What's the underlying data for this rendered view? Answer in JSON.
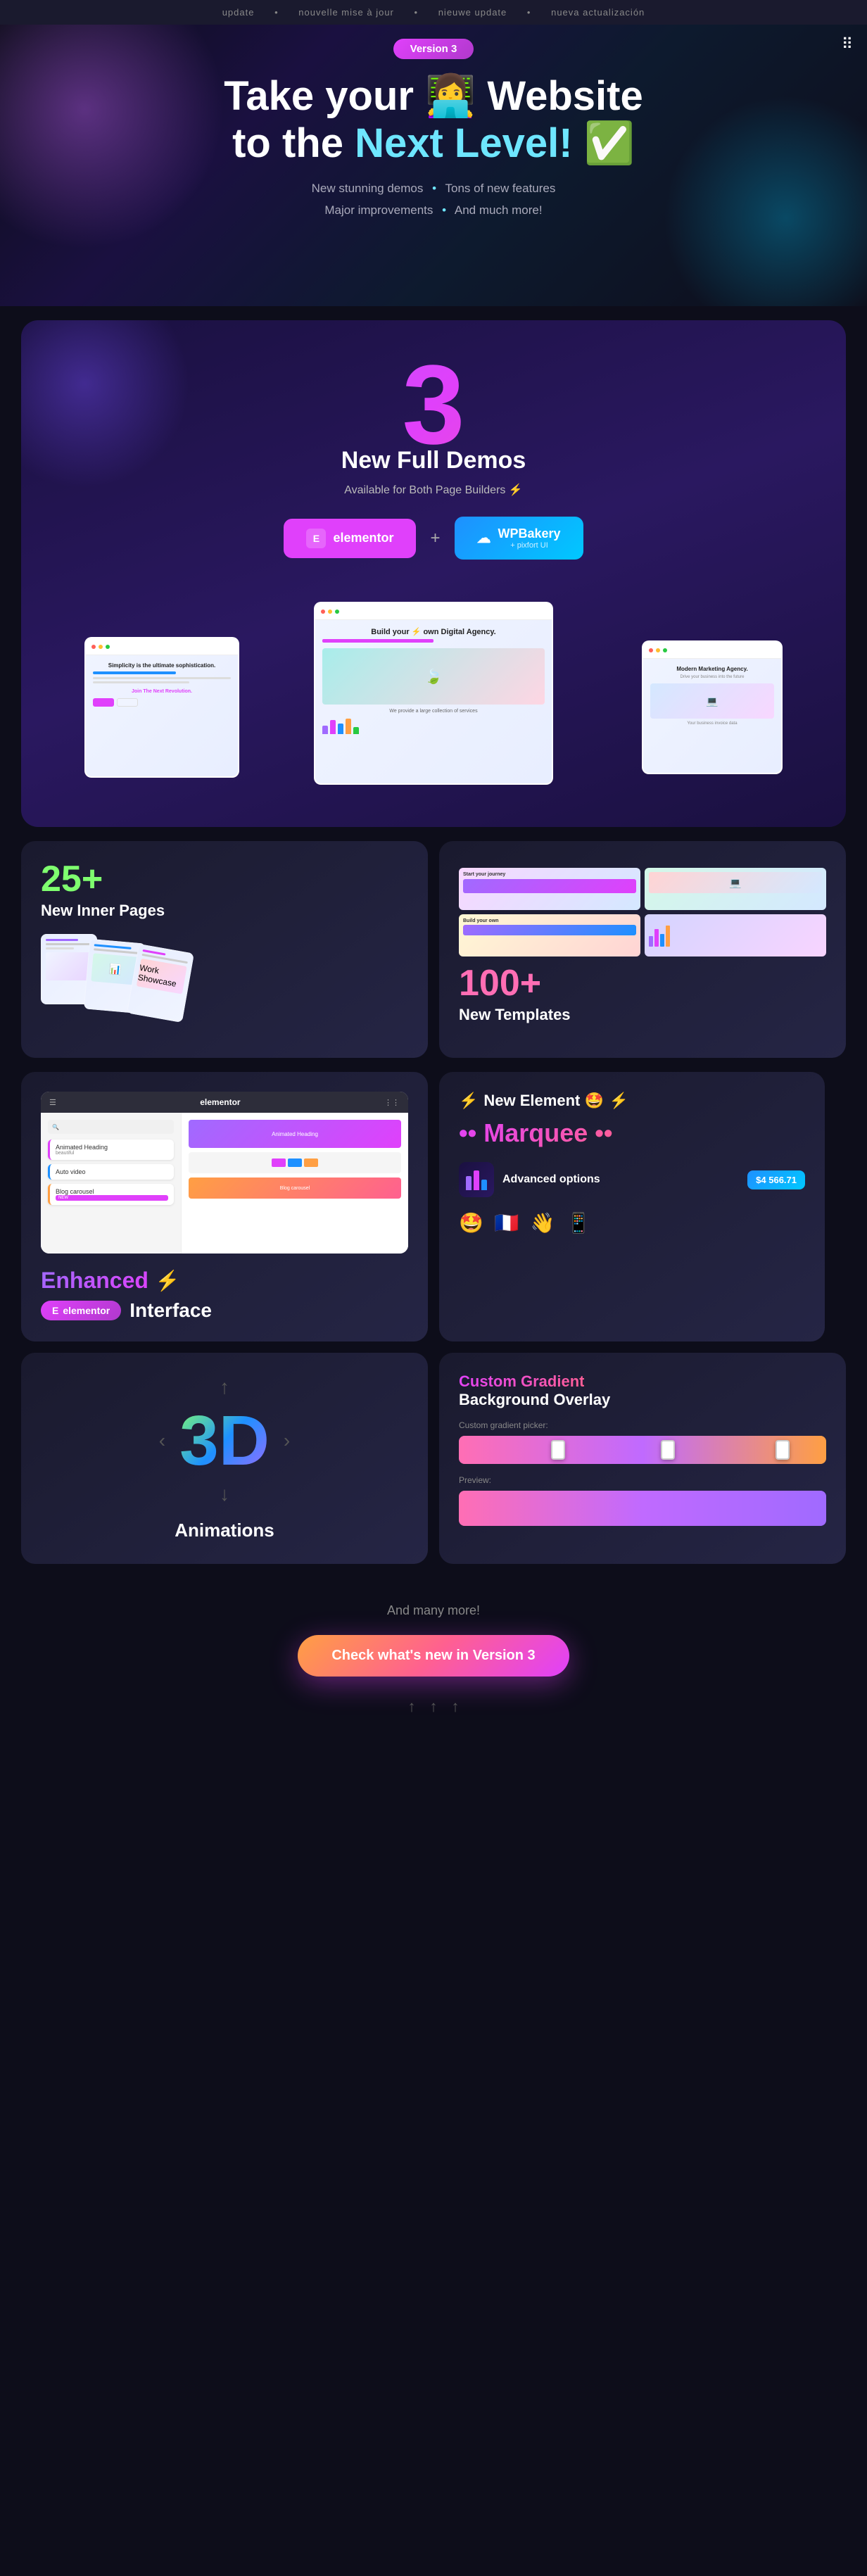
{
  "topMarquee": {
    "items": [
      "update",
      "nouvelle mise à jour",
      "nieuwe update",
      "nueva actualización"
    ]
  },
  "topIcon": "⠿",
  "hero": {
    "versionBadge": "Version 3",
    "titleLine1": "Take your 👩‍💻 Website",
    "titleLine2_plain": "to the ",
    "titleLine2_highlight": "Next Level!",
    "titleLine2_emoji": " ✅",
    "features": [
      "New stunning demos",
      "Tons of new features",
      "Major improvements",
      "And much more!"
    ]
  },
  "demos": {
    "number": "3",
    "title": "New Full Demos",
    "subtitle": "Available for Both Page Builders ⚡",
    "elementorLabel": "elementor",
    "wpbakeryLabel": "WPBakery",
    "wpbakerySubLabel": "+ pixfort UI"
  },
  "innerPages": {
    "stat": "25+",
    "label": "New Inner Pages"
  },
  "templates": {
    "stat": "100+",
    "label": "New Templates"
  },
  "elementorSection": {
    "enhancedText": "Enhanced",
    "lightning": "⚡",
    "interfaceText": "Interface",
    "badgeText": "elementor",
    "sidebarItems": [
      {
        "label": "Animated Heading",
        "sub": "beautiful"
      },
      {
        "label": "Auto video"
      },
      {
        "label": "Blog carousel"
      }
    ]
  },
  "marqueeSection": {
    "newElementLabel": "New Element 🤩",
    "marqueeText": "•• Marquee ••",
    "advancedOptionsLabel": "Advanced options",
    "priceLabel": "$4 566.71",
    "emojis": [
      "🤩",
      "🇫🇷",
      "👋",
      "📱"
    ]
  },
  "threeDSection": {
    "text": "3D",
    "label": "Animations"
  },
  "gradientSection": {
    "titleColored": "Custom Gradient",
    "titleWhite": "Background Overlay",
    "pickerLabel": "Custom gradient picker:",
    "previewLabel": "Preview:"
  },
  "bottom": {
    "andMore": "And many more!",
    "ctaLabel": "Check what's new in Version 3"
  }
}
